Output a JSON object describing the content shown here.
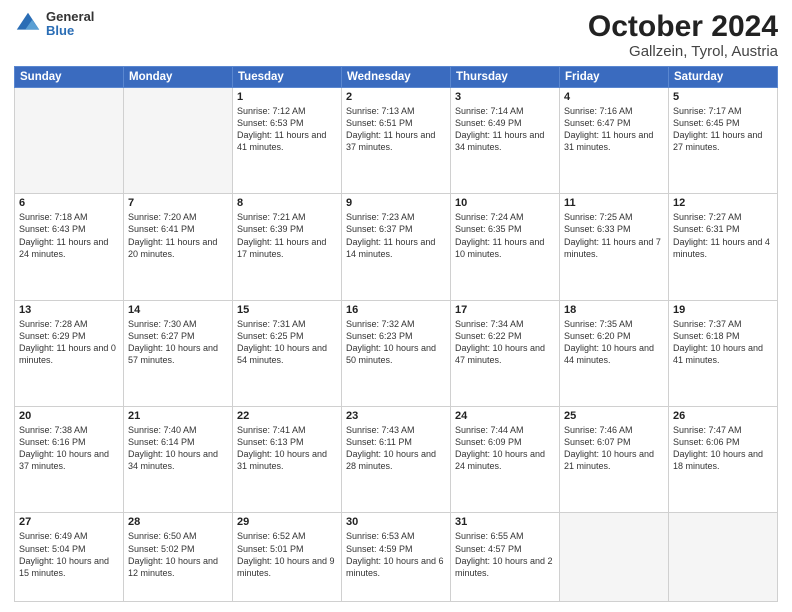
{
  "logo": {
    "general": "General",
    "blue": "Blue"
  },
  "title": "October 2024",
  "subtitle": "Gallzein, Tyrol, Austria",
  "days_of_week": [
    "Sunday",
    "Monday",
    "Tuesday",
    "Wednesday",
    "Thursday",
    "Friday",
    "Saturday"
  ],
  "weeks": [
    [
      {
        "day": "",
        "empty": true
      },
      {
        "day": "",
        "empty": true
      },
      {
        "day": "1",
        "sunrise": "7:12 AM",
        "sunset": "6:53 PM",
        "daylight": "11 hours and 41 minutes."
      },
      {
        "day": "2",
        "sunrise": "7:13 AM",
        "sunset": "6:51 PM",
        "daylight": "11 hours and 37 minutes."
      },
      {
        "day": "3",
        "sunrise": "7:14 AM",
        "sunset": "6:49 PM",
        "daylight": "11 hours and 34 minutes."
      },
      {
        "day": "4",
        "sunrise": "7:16 AM",
        "sunset": "6:47 PM",
        "daylight": "11 hours and 31 minutes."
      },
      {
        "day": "5",
        "sunrise": "7:17 AM",
        "sunset": "6:45 PM",
        "daylight": "11 hours and 27 minutes."
      }
    ],
    [
      {
        "day": "6",
        "sunrise": "7:18 AM",
        "sunset": "6:43 PM",
        "daylight": "11 hours and 24 minutes."
      },
      {
        "day": "7",
        "sunrise": "7:20 AM",
        "sunset": "6:41 PM",
        "daylight": "11 hours and 20 minutes."
      },
      {
        "day": "8",
        "sunrise": "7:21 AM",
        "sunset": "6:39 PM",
        "daylight": "11 hours and 17 minutes."
      },
      {
        "day": "9",
        "sunrise": "7:23 AM",
        "sunset": "6:37 PM",
        "daylight": "11 hours and 14 minutes."
      },
      {
        "day": "10",
        "sunrise": "7:24 AM",
        "sunset": "6:35 PM",
        "daylight": "11 hours and 10 minutes."
      },
      {
        "day": "11",
        "sunrise": "7:25 AM",
        "sunset": "6:33 PM",
        "daylight": "11 hours and 7 minutes."
      },
      {
        "day": "12",
        "sunrise": "7:27 AM",
        "sunset": "6:31 PM",
        "daylight": "11 hours and 4 minutes."
      }
    ],
    [
      {
        "day": "13",
        "sunrise": "7:28 AM",
        "sunset": "6:29 PM",
        "daylight": "11 hours and 0 minutes."
      },
      {
        "day": "14",
        "sunrise": "7:30 AM",
        "sunset": "6:27 PM",
        "daylight": "10 hours and 57 minutes."
      },
      {
        "day": "15",
        "sunrise": "7:31 AM",
        "sunset": "6:25 PM",
        "daylight": "10 hours and 54 minutes."
      },
      {
        "day": "16",
        "sunrise": "7:32 AM",
        "sunset": "6:23 PM",
        "daylight": "10 hours and 50 minutes."
      },
      {
        "day": "17",
        "sunrise": "7:34 AM",
        "sunset": "6:22 PM",
        "daylight": "10 hours and 47 minutes."
      },
      {
        "day": "18",
        "sunrise": "7:35 AM",
        "sunset": "6:20 PM",
        "daylight": "10 hours and 44 minutes."
      },
      {
        "day": "19",
        "sunrise": "7:37 AM",
        "sunset": "6:18 PM",
        "daylight": "10 hours and 41 minutes."
      }
    ],
    [
      {
        "day": "20",
        "sunrise": "7:38 AM",
        "sunset": "6:16 PM",
        "daylight": "10 hours and 37 minutes."
      },
      {
        "day": "21",
        "sunrise": "7:40 AM",
        "sunset": "6:14 PM",
        "daylight": "10 hours and 34 minutes."
      },
      {
        "day": "22",
        "sunrise": "7:41 AM",
        "sunset": "6:13 PM",
        "daylight": "10 hours and 31 minutes."
      },
      {
        "day": "23",
        "sunrise": "7:43 AM",
        "sunset": "6:11 PM",
        "daylight": "10 hours and 28 minutes."
      },
      {
        "day": "24",
        "sunrise": "7:44 AM",
        "sunset": "6:09 PM",
        "daylight": "10 hours and 24 minutes."
      },
      {
        "day": "25",
        "sunrise": "7:46 AM",
        "sunset": "6:07 PM",
        "daylight": "10 hours and 21 minutes."
      },
      {
        "day": "26",
        "sunrise": "7:47 AM",
        "sunset": "6:06 PM",
        "daylight": "10 hours and 18 minutes."
      }
    ],
    [
      {
        "day": "27",
        "sunrise": "6:49 AM",
        "sunset": "5:04 PM",
        "daylight": "10 hours and 15 minutes."
      },
      {
        "day": "28",
        "sunrise": "6:50 AM",
        "sunset": "5:02 PM",
        "daylight": "10 hours and 12 minutes."
      },
      {
        "day": "29",
        "sunrise": "6:52 AM",
        "sunset": "5:01 PM",
        "daylight": "10 hours and 9 minutes."
      },
      {
        "day": "30",
        "sunrise": "6:53 AM",
        "sunset": "4:59 PM",
        "daylight": "10 hours and 6 minutes."
      },
      {
        "day": "31",
        "sunrise": "6:55 AM",
        "sunset": "4:57 PM",
        "daylight": "10 hours and 2 minutes."
      },
      {
        "day": "",
        "empty": true
      },
      {
        "day": "",
        "empty": true
      }
    ]
  ]
}
